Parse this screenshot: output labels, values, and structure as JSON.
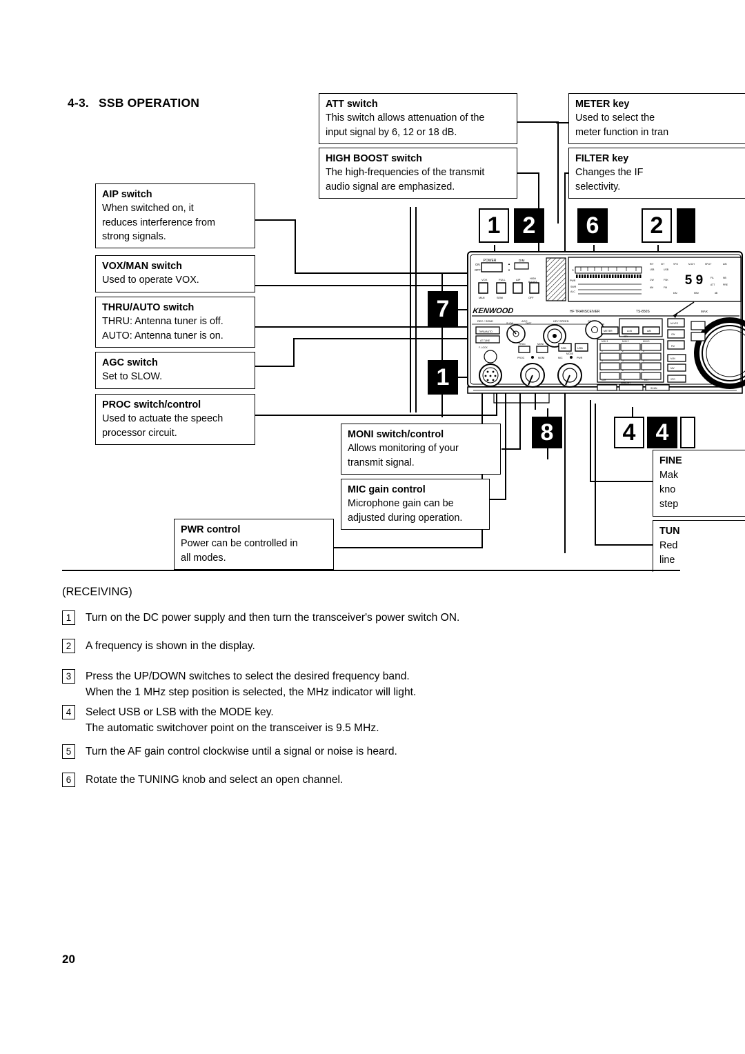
{
  "section": {
    "number": "4-3.",
    "title": "SSB OPERATION"
  },
  "callouts": [
    {
      "id": "aip",
      "title": "AIP switch",
      "lines": [
        "When switched on, it",
        "reduces interference from",
        "strong signals."
      ]
    },
    {
      "id": "vox-man",
      "title": "VOX/MAN switch",
      "lines": [
        "Used to operate VOX."
      ]
    },
    {
      "id": "thru-auto",
      "title": "THRU/AUTO switch",
      "lines": [
        "THRU: Antenna tuner is off.",
        "AUTO: Antenna tuner is on."
      ]
    },
    {
      "id": "agc",
      "title": "AGC switch",
      "lines": [
        "Set to SLOW."
      ]
    },
    {
      "id": "proc",
      "title": "PROC switch/control",
      "lines": [
        "Used to actuate the speech",
        "processor circuit."
      ]
    },
    {
      "id": "att",
      "title": "ATT switch",
      "lines": [
        "This switch allows attenuation of the",
        "input signal by 6, 12 or 18 dB."
      ]
    },
    {
      "id": "high-boost",
      "title": "HIGH BOOST switch",
      "lines": [
        "The high-frequencies of the transmit",
        "audio signal are emphasized."
      ]
    },
    {
      "id": "moni",
      "title": "MONI switch/control",
      "lines": [
        "Allows monitoring of your",
        "transmit signal."
      ]
    },
    {
      "id": "mic-gain",
      "title": "MIC gain control",
      "lines": [
        "Microphone gain can be",
        "adjusted during operation."
      ]
    },
    {
      "id": "pwr",
      "title": "PWR control",
      "lines": [
        "Power can be controlled in",
        "all modes."
      ]
    },
    {
      "id": "meter",
      "title": "METER key",
      "lines": [
        "Used to select the",
        "meter function in tran"
      ]
    },
    {
      "id": "filter",
      "title": "FILTER key",
      "lines": [
        "Changes the IF",
        "selectivity."
      ]
    },
    {
      "id": "fine",
      "title": "FINE",
      "lines": [
        "Mak",
        "kno",
        "step"
      ]
    },
    {
      "id": "tun",
      "title": "TUN",
      "lines": [
        "Red",
        "line"
      ]
    }
  ],
  "badges": [
    {
      "id": "b1",
      "label": "1",
      "style": "light"
    },
    {
      "id": "b2",
      "label": "2",
      "style": "dark"
    },
    {
      "id": "b6",
      "label": "6",
      "style": "dark"
    },
    {
      "id": "b2b",
      "label": "2",
      "style": "light"
    },
    {
      "id": "b-edge-top",
      "label": "",
      "style": "dark"
    },
    {
      "id": "b7",
      "label": "7",
      "style": "dark"
    },
    {
      "id": "b1b",
      "label": "1",
      "style": "dark"
    },
    {
      "id": "b8",
      "label": "8",
      "style": "dark"
    },
    {
      "id": "b4",
      "label": "4",
      "style": "light"
    },
    {
      "id": "b4b",
      "label": "4",
      "style": "dark"
    },
    {
      "id": "b-edge-bottom",
      "label": "",
      "style": "light"
    }
  ],
  "radio": {
    "brand": "KENWOOD",
    "model": "TS-850S",
    "descriptor": "HF TRANSCEIVER",
    "labels": {
      "power": "POWER",
      "on": "ON",
      "off": "OFF",
      "dim": "DIM",
      "vox_man": "VOX  MAN",
      "aip": "AIP",
      "high_boost": "HIGH BOOST",
      "agc": "AGC",
      "rec_send": "REC/SEND",
      "key_speed": "KEY SPEED",
      "car": "CAR",
      "mic": "MIC",
      "proc": "PROC",
      "moni": "MONI",
      "pwr": "PWR",
      "ssb": "SSB",
      "usb": "USB",
      "meter": "METER",
      "mode": "MODE",
      "key": "KEY",
      "memory": "MEMORY",
      "scan": "SCAN",
      "clr": "CLR",
      "ent": "ENT",
      "thru_auto": "THRU / AUTO",
      "at_tune": "AT TUNE",
      "finder": "F.LOCK",
      "smeter_display": "5 9"
    }
  },
  "receiving": {
    "heading": "(RECEIVING)",
    "steps": [
      {
        "num": "1",
        "lines": [
          "Turn on the DC power supply and then turn the transceiver's power switch ON."
        ]
      },
      {
        "num": "2",
        "lines": [
          "A frequency is shown in the display."
        ]
      },
      {
        "num": "3",
        "lines": [
          "Press the UP/DOWN switches to select the desired frequency band.",
          "When the 1 MHz step position is selected, the MHz indicator will light."
        ]
      },
      {
        "num": "4",
        "lines": [
          "Select USB or LSB with the MODE key.",
          "The automatic switchover point on the transceiver is 9.5 MHz."
        ]
      },
      {
        "num": "5",
        "lines": [
          "Turn the AF gain control clockwise until a signal or noise is heard."
        ]
      },
      {
        "num": "6",
        "lines": [
          "Rotate the TUNING knob and select an open channel."
        ]
      }
    ]
  },
  "page_number": "20",
  "colors": {
    "ink": "#000000",
    "paper": "#ffffff"
  }
}
